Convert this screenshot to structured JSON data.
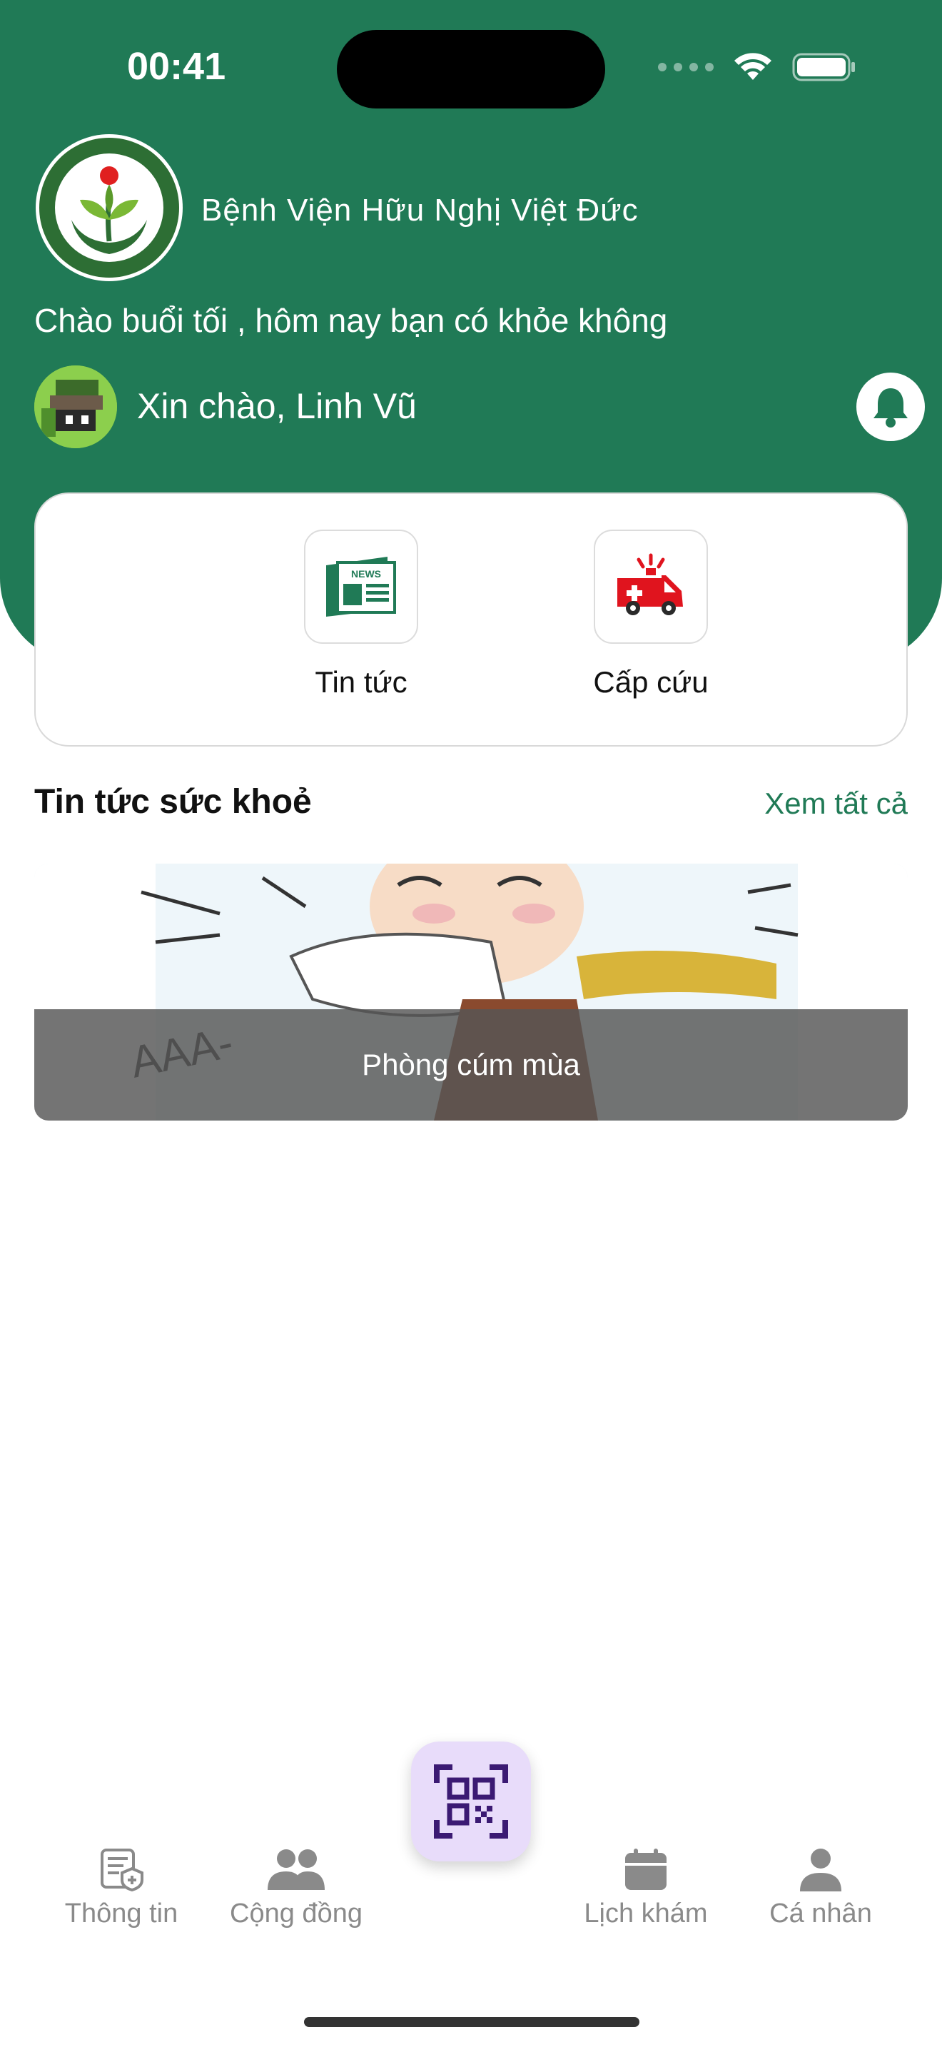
{
  "status_bar": {
    "time": "00:41"
  },
  "header": {
    "hospital_name": "Bệnh Viện Hữu Nghị Việt Đức",
    "greeting": "Chào buổi tối , hôm nay bạn có khỏe không",
    "hello": "Xin chào, Linh Vũ",
    "logo_icon": "hospital-logo",
    "bell_icon": "bell-icon",
    "brand_color": "#207a56"
  },
  "quick_actions": [
    {
      "label": "Tin tức",
      "icon": "news-icon"
    },
    {
      "label": "Cấp cứu",
      "icon": "ambulance-icon"
    }
  ],
  "news_section": {
    "title": "Tin tức sức khoẻ",
    "see_all": "Xem tất cả",
    "items": [
      {
        "title": "Phòng cúm mùa"
      }
    ]
  },
  "tabbar": {
    "tabs": [
      {
        "label": "Thông tin",
        "icon": "info-doc-icon"
      },
      {
        "label": "Cộng đồng",
        "icon": "community-icon"
      },
      {
        "label": "Lịch khám",
        "icon": "calendar-icon"
      },
      {
        "label": "Cá nhân",
        "icon": "person-icon"
      }
    ],
    "center_icon": "qr-code-icon",
    "accent_color": "#3b1a73"
  }
}
